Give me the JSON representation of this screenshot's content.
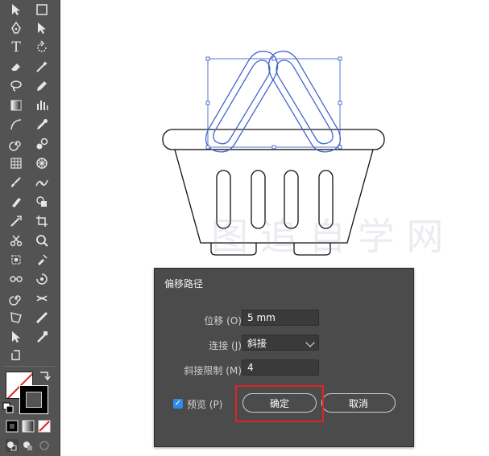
{
  "toolbar": {
    "tools": [
      {
        "icon": "selection-tool-icon"
      },
      {
        "icon": "rectangle-tool-icon"
      },
      {
        "icon": "pen-tool-icon"
      },
      {
        "icon": "direct-selection-tool-icon"
      },
      {
        "icon": "type-tool-icon",
        "glyph": "T"
      },
      {
        "icon": "rotate-tool-icon"
      },
      {
        "icon": "eraser-tool-icon"
      },
      {
        "icon": "magic-wand-tool-icon"
      },
      {
        "icon": "lasso-tool-icon"
      },
      {
        "icon": "pencil-tool-icon"
      },
      {
        "icon": "gradient-tool-icon"
      },
      {
        "icon": "column-graph-tool-icon"
      },
      {
        "icon": "arc-tool-icon"
      },
      {
        "icon": "eyedropper-tool-icon"
      },
      {
        "icon": "spiral-tool-icon"
      },
      {
        "icon": "blend-tool-icon"
      },
      {
        "icon": "mesh-tool-icon"
      },
      {
        "icon": "symbol-sprayer-tool-icon"
      },
      {
        "icon": "brush-tool-icon"
      },
      {
        "icon": "puppet-warp-tool-icon"
      },
      {
        "icon": "blob-brush-tool-icon"
      },
      {
        "icon": "shape-builder-tool-icon"
      },
      {
        "icon": "scale-tool-icon"
      },
      {
        "icon": "artboard-tool-icon"
      },
      {
        "icon": "scissors-tool-icon"
      },
      {
        "icon": "zoom-tool-icon"
      },
      {
        "icon": "perspective-grid-tool-icon"
      },
      {
        "icon": "live-paint-tool-icon"
      },
      {
        "icon": "slice-tool-icon"
      },
      {
        "icon": "warp-tool-icon"
      },
      {
        "icon": "twirl-tool-icon"
      },
      {
        "icon": "pucker-tool-icon"
      },
      {
        "icon": "free-transform-tool-icon"
      },
      {
        "icon": "measure-tool-icon"
      },
      {
        "icon": "hand-tool-icon"
      },
      {
        "icon": "print-tiling-tool-icon"
      }
    ],
    "colors": {
      "fill": "#ffffff",
      "stroke": "#000000",
      "none_slash": "#e02020"
    }
  },
  "canvas": {
    "watermark": "图 追 自 学 网",
    "path_color": "#4466cc"
  },
  "dialog": {
    "title": "偏移路径",
    "offset": {
      "label": "位移 (O):",
      "value": "5 mm"
    },
    "joins": {
      "label": "连接 (J):",
      "value": "斜接",
      "options": [
        "斜接"
      ]
    },
    "miter_limit": {
      "label": "斜接限制 (M):",
      "value": "4"
    },
    "preview": {
      "label": "预览 (P)",
      "checked": true
    },
    "ok_label": "确定",
    "cancel_label": "取消"
  },
  "colors": {
    "highlight": "#e02424",
    "dialog_bg": "#4b4b4b",
    "toolbar_bg": "#535353"
  }
}
